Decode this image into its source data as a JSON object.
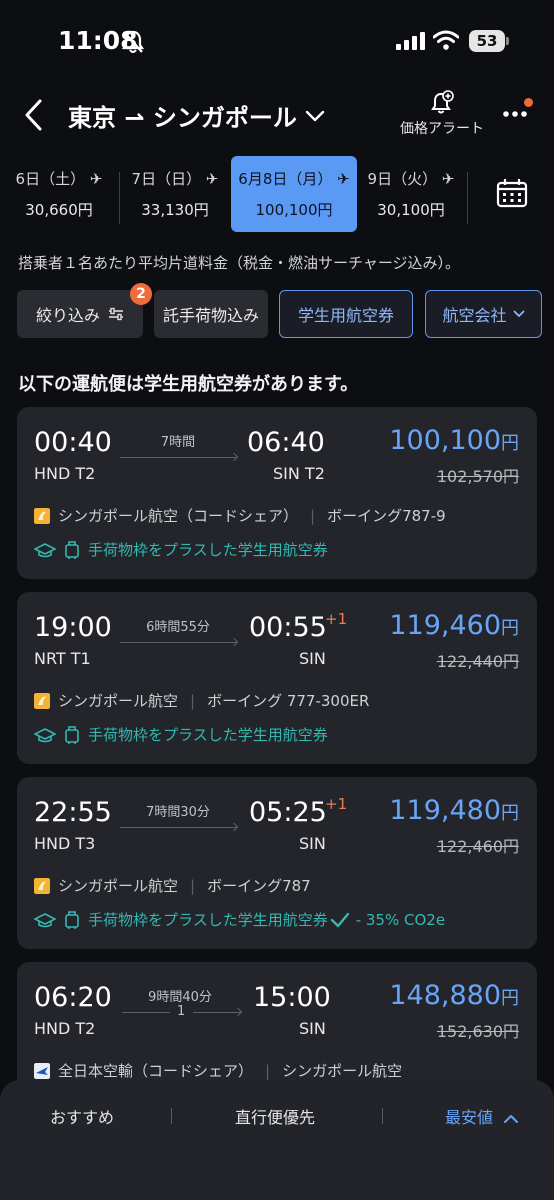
{
  "status_bar": {
    "time": "11:08",
    "battery": "53"
  },
  "header": {
    "route": "東京 ⇀ シンガポール",
    "price_alert_label": "価格アラート"
  },
  "dates": [
    {
      "day": "6日（土）",
      "price": "30,660円"
    },
    {
      "day": "7日（日）",
      "price": "33,130円"
    },
    {
      "day": "6月8日（月）",
      "price": "100,100円",
      "selected": true
    },
    {
      "day": "9日（火）",
      "price": "30,100円"
    }
  ],
  "fare_note": "搭乗者１名あたり平均片道料金（税金・燃油サーチャージ込み）。",
  "filters": {
    "refine": "絞り込み",
    "refine_badge": "2",
    "baggage": "託手荷物込み",
    "student": "学生用航空券",
    "airline": "航空会社"
  },
  "section_heading": "以下の運航便は学生用航空券があります。",
  "flights": [
    {
      "dep_time": "00:40",
      "dep_airport": "HND T2",
      "duration": "7時間",
      "arr_time": "06:40",
      "arr_airport": "SIN T2",
      "price": "100,100",
      "yen": "円",
      "old_price": "102,570円",
      "airline": "シンガポール航空（コードシェア）",
      "aircraft": "ボーイング787-9",
      "perk": "手荷物枠をプラスした学生用航空券"
    },
    {
      "dep_time": "19:00",
      "dep_airport": "NRT T1",
      "duration": "6時間55分",
      "arr_time": "00:55",
      "day_plus": "+1",
      "arr_airport": "SIN",
      "price": "119,460",
      "yen": "円",
      "old_price": "122,440円",
      "airline": "シンガポール航空",
      "aircraft": "ボーイング 777-300ER",
      "perk": "手荷物枠をプラスした学生用航空券"
    },
    {
      "dep_time": "22:55",
      "dep_airport": "HND T3",
      "duration": "7時間30分",
      "arr_time": "05:25",
      "day_plus": "+1",
      "arr_airport": "SIN",
      "price": "119,480",
      "yen": "円",
      "old_price": "122,460円",
      "airline": "シンガポール航空",
      "aircraft": "ボーイング787",
      "perk": "手荷物枠をプラスした学生用航空券",
      "co2": "- 35% CO2e"
    },
    {
      "dep_time": "06:20",
      "dep_airport": "HND T2",
      "duration": "9時間40分",
      "stops": "1",
      "arr_time": "15:00",
      "arr_airport": "SIN",
      "price": "148,880",
      "yen": "円",
      "old_price": "152,630円",
      "airline": "全日本空輸（コードシェア）",
      "aircraft": "シンガポール航空"
    }
  ],
  "sort_bar": {
    "recommended": "おすすめ",
    "direct_first": "直行便優先",
    "cheapest": "最安値"
  },
  "colors": {
    "accent": "#5a9af5",
    "price": "#6aa4f6",
    "perk": "#32b9b3",
    "badge": "#ef6c3a",
    "card": "#23252b"
  }
}
